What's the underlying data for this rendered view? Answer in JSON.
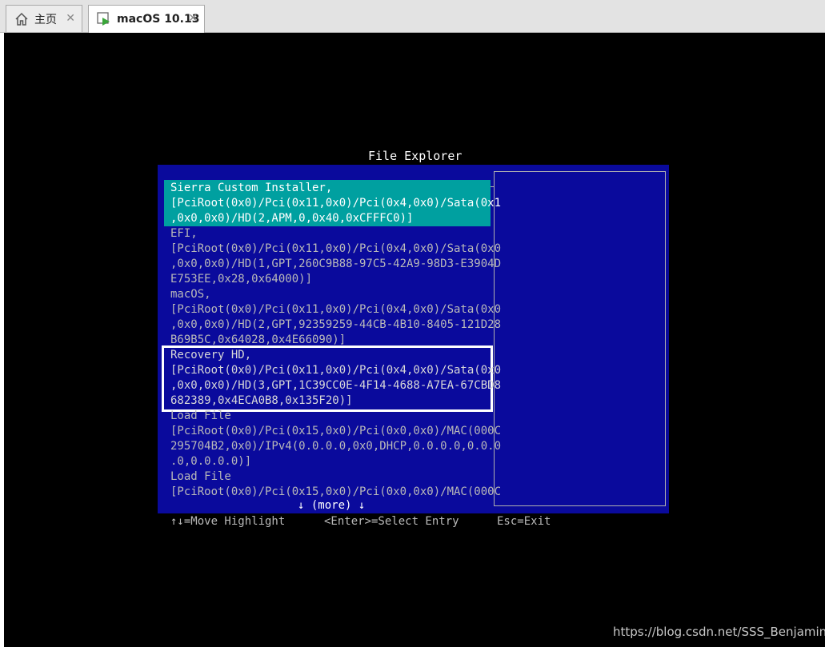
{
  "tabs": [
    {
      "label": "主页",
      "icon": "home-icon"
    },
    {
      "label": "macOS 10.13",
      "icon": "vm-icon"
    }
  ],
  "close_glyph": "✕",
  "file_explorer": {
    "title": "File Explorer",
    "entries": [
      {
        "lines": [
          "Sierra Custom Installer,",
          "[PciRoot(0x0)/Pci(0x11,0x0)/Pci(0x4,0x0)/Sata(0x1",
          ",0x0,0x0)/HD(2,APM,0,0x40,0xCFFFC0)]"
        ],
        "highlighted": true
      },
      {
        "lines": [
          "EFI,",
          "[PciRoot(0x0)/Pci(0x11,0x0)/Pci(0x4,0x0)/Sata(0x0",
          ",0x0,0x0)/HD(1,GPT,260C9B88-97C5-42A9-98D3-E3904D",
          "E753EE,0x28,0x64000)]"
        ]
      },
      {
        "lines": [
          "macOS,",
          "[PciRoot(0x0)/Pci(0x11,0x0)/Pci(0x4,0x0)/Sata(0x0",
          ",0x0,0x0)/HD(2,GPT,92359259-44CB-4B10-8405-121D28",
          "B69B5C,0x64028,0x4E66090)]"
        ]
      },
      {
        "lines": [
          "Recovery HD,",
          "[PciRoot(0x0)/Pci(0x11,0x0)/Pci(0x4,0x0)/Sata(0x0",
          ",0x0,0x0)/HD(3,GPT,1C39CC0E-4F14-4688-A7EA-67CBD8",
          "682389,0x4ECA0B8,0x135F20)]"
        ],
        "selected": true
      },
      {
        "lines": [
          "Load File",
          "[PciRoot(0x0)/Pci(0x15,0x0)/Pci(0x0,0x0)/MAC(000C",
          "295704B2,0x0)/IPv4(0.0.0.0,0x0,DHCP,0.0.0.0,0.0.0",
          ".0,0.0.0.0)]"
        ]
      },
      {
        "lines": [
          "Load File",
          "[PciRoot(0x0)/Pci(0x15,0x0)/Pci(0x0,0x0)/MAC(000C"
        ]
      }
    ],
    "more": "↓ (more) ↓",
    "hints": {
      "move": "↑↓=Move Highlight",
      "select": "<Enter>=Select Entry",
      "exit": "Esc=Exit"
    }
  },
  "watermark": "https://blog.csdn.net/SSS_Benjamin"
}
